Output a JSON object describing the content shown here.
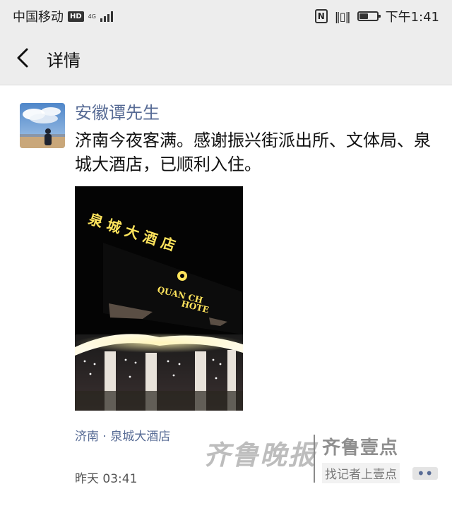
{
  "status_bar": {
    "carrier": "中国移动",
    "hd_badge": "HD",
    "network_top": "4G",
    "network_bottom": "",
    "time": "下午1:41",
    "nfc_label": "N",
    "battery_level": 0.5
  },
  "header": {
    "title": "详情"
  },
  "post": {
    "username": "安徽谭先生",
    "text": "济南今夜客满。感谢振兴街派出所、文体局、泉城大酒店，已顺利入住。",
    "photo": {
      "sign_chinese": "泉城大酒店",
      "sign_english_line1": "QUAN CH",
      "sign_english_line2": "HOTE"
    },
    "location": "济南 · 泉城大酒店",
    "timestamp": "昨天 03:41"
  },
  "watermark": {
    "newspaper": "齐鲁晚报",
    "brand": "齐鲁壹点",
    "slogan": "找记者上壹点",
    "more": "••"
  },
  "colors": {
    "link": "#576b95",
    "bar_bg": "#ededed",
    "sign_gold": "#ffe45c"
  }
}
